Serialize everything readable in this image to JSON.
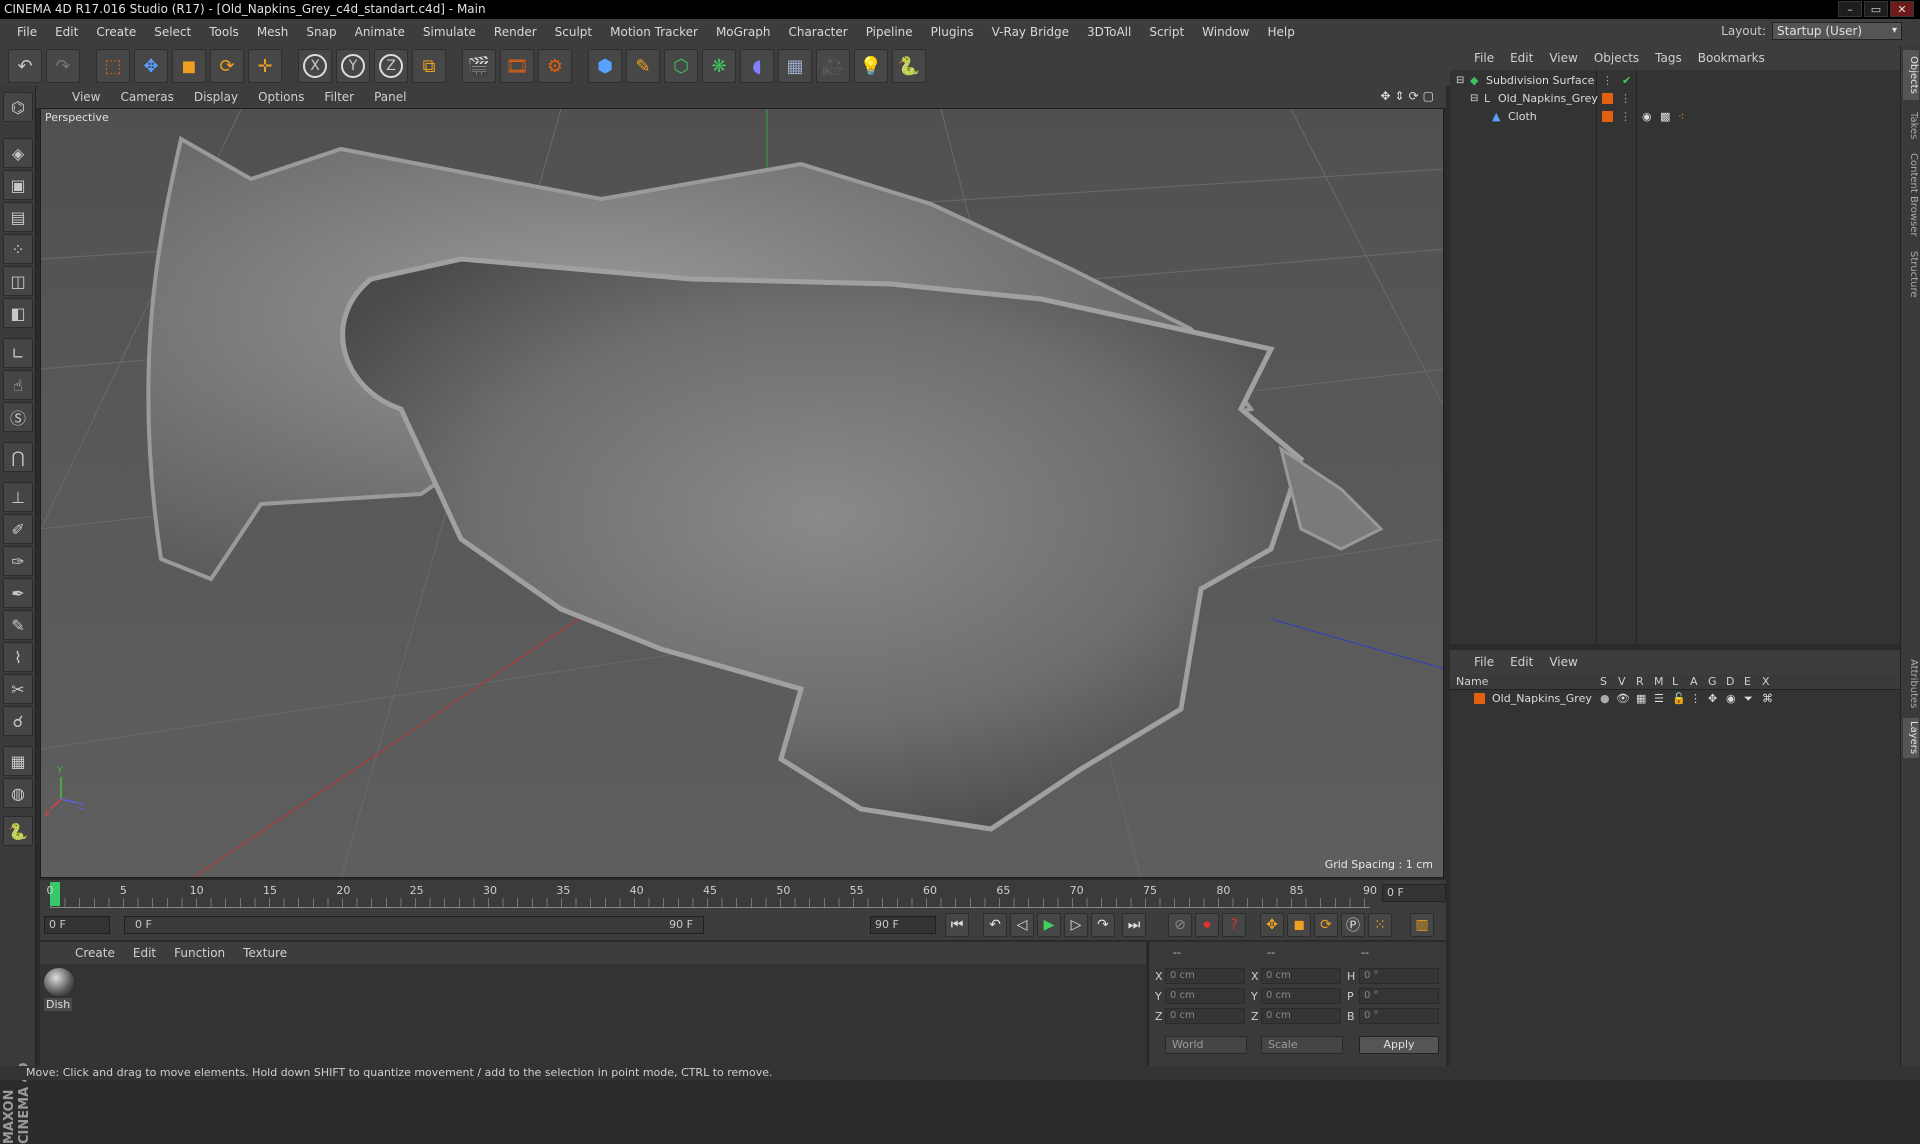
{
  "window": {
    "title": "CINEMA 4D R17.016 Studio (R17) - [Old_Napkins_Grey_c4d_standart.c4d] - Main"
  },
  "menu": [
    "File",
    "Edit",
    "Create",
    "Select",
    "Tools",
    "Mesh",
    "Snap",
    "Animate",
    "Simulate",
    "Render",
    "Sculpt",
    "Motion Tracker",
    "MoGraph",
    "Character",
    "Pipeline",
    "Plugins",
    "V-Ray Bridge",
    "3DToAll",
    "Script",
    "Window",
    "Help"
  ],
  "layout": {
    "label": "Layout:",
    "value": "Startup (User)"
  },
  "toolbar": {
    "axis_x": "X",
    "axis_y": "Y",
    "axis_z": "Z"
  },
  "viewport": {
    "menu": [
      "View",
      "Cameras",
      "Display",
      "Options",
      "Filter",
      "Panel"
    ],
    "label": "Perspective",
    "grid_spacing": "Grid Spacing : 1 cm"
  },
  "timeline": {
    "ticks": [
      "0",
      "5",
      "10",
      "15",
      "20",
      "25",
      "30",
      "35",
      "40",
      "45",
      "50",
      "55",
      "60",
      "65",
      "70",
      "75",
      "80",
      "85",
      "90"
    ],
    "current_frame": "0 F",
    "start_field": "0 F",
    "range_start": "0 F",
    "range_end": "90 F",
    "end_field": "90 F",
    "max_frame": 90
  },
  "material_manager": {
    "menu": [
      "Create",
      "Edit",
      "Function",
      "Texture"
    ],
    "material_name": "Dish"
  },
  "coordinates": {
    "headers": [
      "--",
      "--",
      "--"
    ],
    "rows": [
      {
        "a": "X",
        "av": "0 cm",
        "b": "X",
        "bv": "0 cm",
        "c": "H",
        "cv": "0 °"
      },
      {
        "a": "Y",
        "av": "0 cm",
        "b": "Y",
        "bv": "0 cm",
        "c": "P",
        "cv": "0 °"
      },
      {
        "a": "Z",
        "av": "0 cm",
        "b": "Z",
        "bv": "0 cm",
        "c": "B",
        "cv": "0 °"
      }
    ],
    "space": "World",
    "mode": "Scale",
    "apply": "Apply"
  },
  "status": "Move: Click and drag to move elements. Hold down SHIFT to quantize movement / add to the selection in point mode, CTRL to remove.",
  "object_manager": {
    "menu": [
      "File",
      "Edit",
      "View",
      "Objects",
      "Tags",
      "Bookmarks"
    ],
    "objects": [
      {
        "name": "Subdivision Surface",
        "indent": 0
      },
      {
        "name": "Old_Napkins_Grey",
        "indent": 1
      },
      {
        "name": "Cloth",
        "indent": 2
      }
    ]
  },
  "layer_manager": {
    "menu": [
      "File",
      "Edit",
      "View"
    ],
    "columns": [
      "Name",
      "S",
      "V",
      "R",
      "M",
      "L",
      "A",
      "G",
      "D",
      "E",
      "X"
    ],
    "layers": [
      {
        "name": "Old_Napkins_Grey",
        "color": "#e06010"
      }
    ]
  },
  "right_tabs": [
    "Objects",
    "Takes",
    "Content Browser",
    "Structure",
    "Attributes",
    "Layers"
  ],
  "logo_text": "MAXON CINEMA 4D",
  "colors": {
    "accent_orange": "#e06010",
    "playhead": "#36c96a"
  }
}
